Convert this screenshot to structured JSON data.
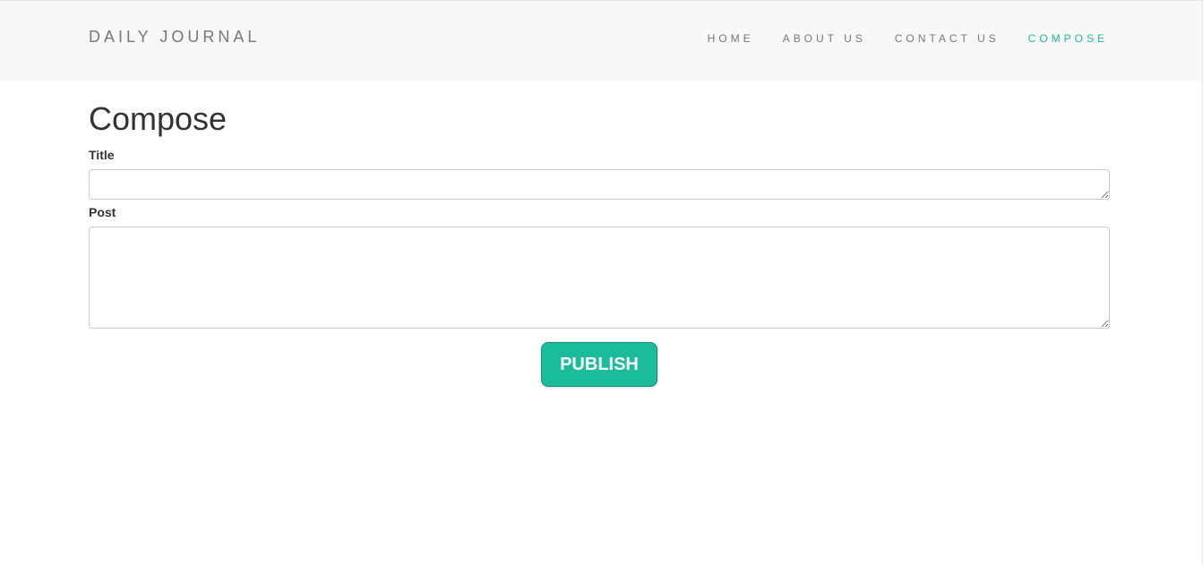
{
  "navbar": {
    "brand": "DAILY JOURNAL",
    "links": [
      {
        "label": "HOME",
        "active": false
      },
      {
        "label": "ABOUT US",
        "active": false
      },
      {
        "label": "CONTACT US",
        "active": false
      },
      {
        "label": "COMPOSE",
        "active": true
      }
    ]
  },
  "main": {
    "title": "Compose",
    "form": {
      "title_label": "Title",
      "title_value": "",
      "post_label": "Post",
      "post_value": "",
      "publish_label": "PUBLISH"
    }
  },
  "colors": {
    "accent": "#1abc9c",
    "navbar_bg": "#f8f8f8",
    "nav_text": "#777777",
    "heading_text": "#333333"
  }
}
